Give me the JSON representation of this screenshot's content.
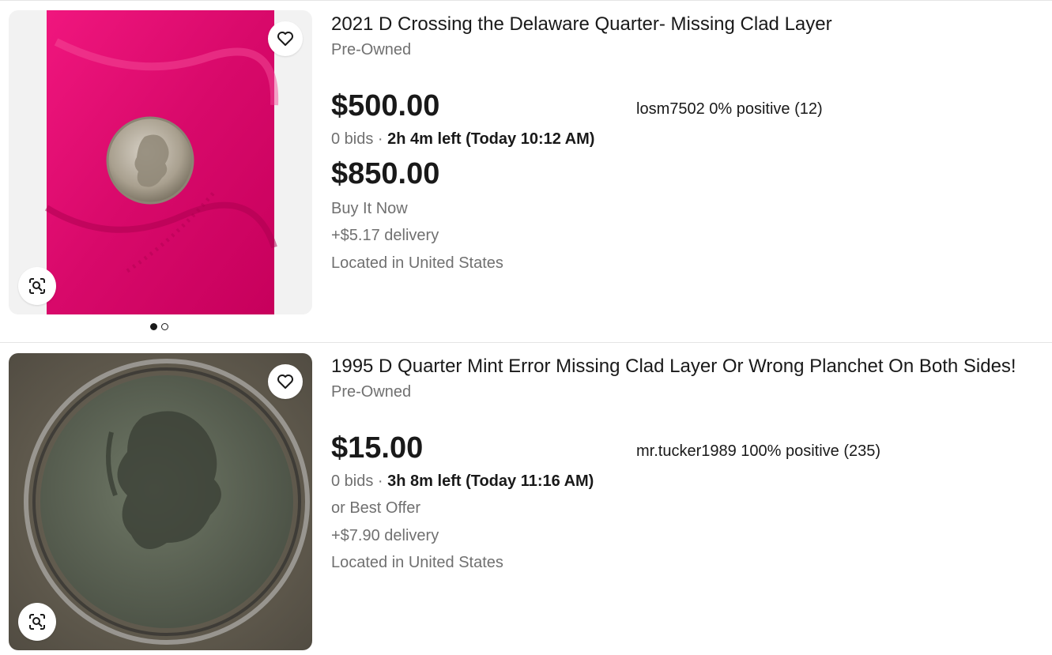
{
  "listings": [
    {
      "title": "2021 D Crossing the Delaware Quarter- Missing Clad Layer",
      "condition": "Pre-Owned",
      "price": "$500.00",
      "seller": "losm7502 0% positive (12)",
      "bids": "0 bids",
      "separator": " · ",
      "time_left": "2h 4m left (Today 10:12 AM)",
      "price2": "$850.00",
      "buy_format": "Buy It Now",
      "delivery": "+$5.17 delivery",
      "location": "Located in United States"
    },
    {
      "title": "1995 D Quarter Mint Error Missing Clad Layer Or Wrong Planchet On Both Sides!",
      "condition": "Pre-Owned",
      "price": "$15.00",
      "seller": "mr.tucker1989 100% positive (235)",
      "bids": "0 bids",
      "separator": " · ",
      "time_left": "3h 8m left (Today 11:16 AM)",
      "offer": "or Best Offer",
      "delivery": "+$7.90 delivery",
      "location": "Located in United States"
    }
  ],
  "colors": {
    "text_primary": "#191919",
    "text_secondary": "#707070",
    "fabric_pink": "#e0106e",
    "coin_stone": "#5f5a51"
  },
  "icons": [
    "heart-icon",
    "visual-search-icon"
  ]
}
